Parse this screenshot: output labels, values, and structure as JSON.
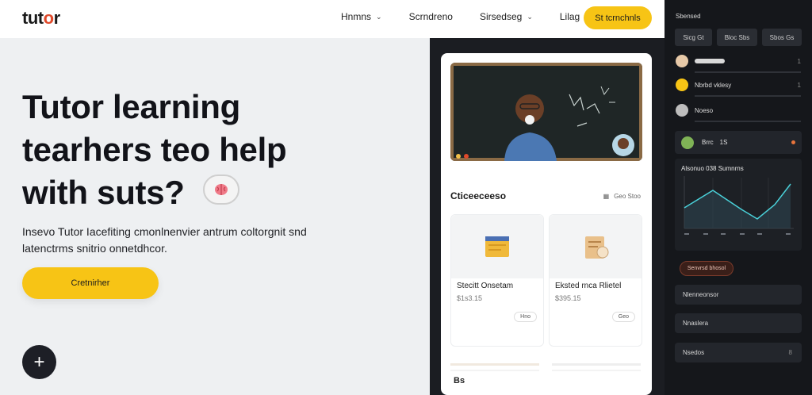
{
  "header": {
    "logo": "tutor",
    "nav": [
      {
        "label": "Hnmns"
      },
      {
        "label": "Scrndreno"
      },
      {
        "label": "Sirsedseg"
      },
      {
        "label": "Lilag"
      }
    ],
    "cta": "St tcrnchnls"
  },
  "hero": {
    "title": "Tutor learning tearhers teo help with suts?",
    "subtitle": "Insevo Tutor Iacefiting cmonlnenvier antrum coltorgnit snd latenctrms snitrio onnetdhcor.",
    "button": "Cretnirher"
  },
  "course_card": {
    "section_title": "Cticeeceeso",
    "section_meta": "Geo Stoo",
    "courses": [
      {
        "title": "Stecitt Onsetam",
        "price": "$1s3.15",
        "pill": "Hno"
      },
      {
        "title": "Eksted rnca Rlietel",
        "price": "$395.15",
        "pill": "Geo"
      }
    ],
    "bottom_label": "Bs"
  },
  "sidebar": {
    "title": "Sbensed",
    "chips": [
      "Sicg Gt",
      "Bloc Sbs",
      "Sbos Gs"
    ],
    "rows": [
      {
        "label": "",
        "end": "1"
      },
      {
        "label": "Nbrbd vklesy",
        "end": "1"
      },
      {
        "label": "Noeso",
        "end": ""
      }
    ],
    "featured": {
      "label": "Brrc",
      "value": "1S"
    },
    "chart_title": "Alsonuo 038 Sumnrns",
    "pill": "Senvrsd bhosol",
    "items": [
      {
        "label": "Nlenneonsor",
        "end": ""
      },
      {
        "label": "Nnaslera",
        "end": ""
      },
      {
        "label": "Nsedos",
        "end": "8"
      }
    ]
  },
  "colors": {
    "accent": "#f7c415",
    "dark": "#1b1d22",
    "chart_line": "#4ad1d9"
  }
}
